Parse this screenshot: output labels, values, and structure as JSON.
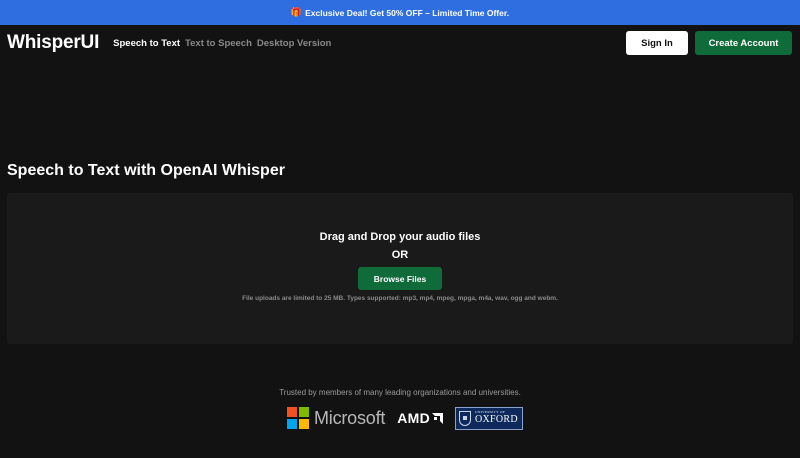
{
  "promo": {
    "icon": "gift-icon",
    "text": "Exclusive Deal! Get 50% OFF – Limited Time Offer."
  },
  "header": {
    "logo": "WhisperUI",
    "nav": [
      {
        "label": "Speech to Text",
        "active": true
      },
      {
        "label": "Text to Speech",
        "active": false
      },
      {
        "label": "Desktop Version",
        "active": false
      }
    ],
    "sign_in": "Sign In",
    "create_account": "Create Account"
  },
  "main": {
    "title": "Speech to Text with OpenAI Whisper",
    "dropzone": {
      "heading": "Drag and Drop your audio files",
      "or": "OR",
      "browse": "Browse Files",
      "note": "File uploads are limited to 25 MB. Types supported: mp3, mp4, mpeg, mpga, m4a, wav, ogg and webm."
    }
  },
  "trusted": {
    "text": "Trusted by members of many leading organizations and universities.",
    "logos": {
      "microsoft": "Microsoft",
      "amd": "AMD",
      "oxford_small": "UNIVERSITY OF",
      "oxford_big": "OXFORD"
    }
  },
  "colors": {
    "background": "#121212",
    "promo_bar": "#2f6ee0",
    "accent_green": "#0f6b3a",
    "panel": "#1a1a1a"
  }
}
